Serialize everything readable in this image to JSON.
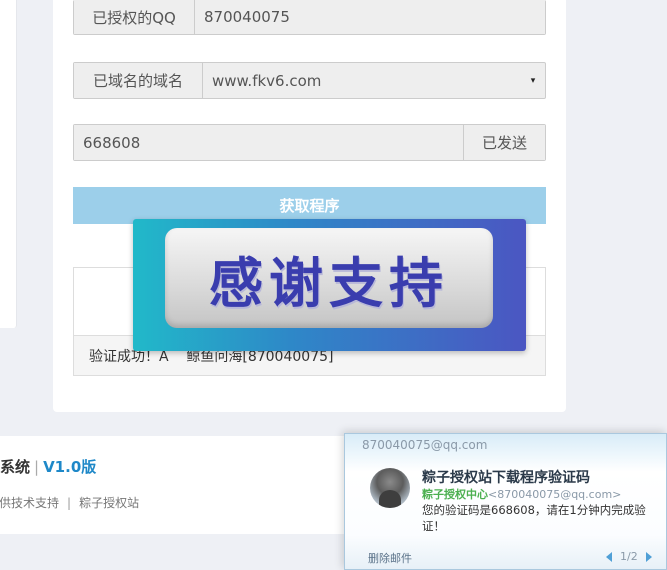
{
  "form": {
    "qq_label": "已授权的QQ",
    "qq_value": "870040075",
    "domain_label": "已域名的域名",
    "domain_value": "www.fkv6.com",
    "code_value": "668608",
    "sent_button": "已发送",
    "submit_button": "获取程序",
    "result_text": "验证成功！A    鲸鱼问海[870040075]"
  },
  "banner": {
    "text": "感谢支持"
  },
  "footer": {
    "title": "授权系统",
    "separator": "|",
    "version": "V1.0版",
    "support_text": "提供技术支持",
    "pipe": "|",
    "site_link": "粽子授权站"
  },
  "notification": {
    "account": "870040075@qq.com",
    "subject": "粽子授权站下载程序验证码",
    "sender_name": "粽子授权中心",
    "sender_email": "<870040075@qq.com>",
    "body": "您的验证码是668608，请在1分钟内完成验证！",
    "delete_label": "删除邮件",
    "page": "1/2",
    "colors": {
      "accent": "#4f9fd6",
      "sender": "#4caf50"
    }
  },
  "colors": {
    "submit_bg": "#9ccfea",
    "banner_text": "#3a3dae",
    "version": "#1e88c8"
  }
}
